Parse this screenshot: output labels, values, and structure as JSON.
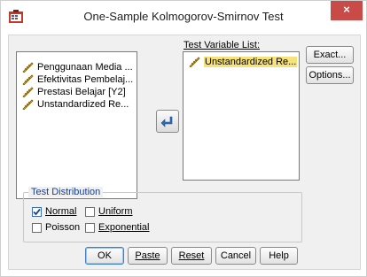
{
  "window": {
    "title": "One-Sample Kolmogorov-Smirnov Test",
    "close_glyph": "×",
    "icon": "spss-dialog-icon"
  },
  "source_list": {
    "items": [
      {
        "label": "Penggunaan Media ...",
        "icon": "scale-variable-icon"
      },
      {
        "label": "Efektivitas Pembelaj...",
        "icon": "scale-variable-icon"
      },
      {
        "label": "Prestasi Belajar [Y2]",
        "icon": "scale-variable-icon"
      },
      {
        "label": "Unstandardized Re...",
        "icon": "scale-variable-icon"
      }
    ]
  },
  "test_variable_list": {
    "label": "Test Variable List:",
    "items": [
      {
        "label": "Unstandardized Re...",
        "icon": "scale-variable-icon",
        "selected": true
      }
    ]
  },
  "move_button": {
    "icon": "arrow-left-icon"
  },
  "side_buttons": {
    "exact": "Exact...",
    "options": "Options..."
  },
  "test_distribution": {
    "legend": "Test Distribution",
    "normal": {
      "label": "Normal",
      "checked": true
    },
    "uniform": {
      "label": "Uniform",
      "checked": false
    },
    "poisson": {
      "label": "Poisson",
      "checked": false
    },
    "exponential": {
      "label": "Exponential",
      "checked": false
    }
  },
  "bottom_buttons": {
    "ok": "OK",
    "paste": "Paste",
    "reset": "Reset",
    "cancel": "Cancel",
    "help": "Help"
  },
  "colors": {
    "selection": "#f6e27a",
    "close": "#c94b47",
    "legend": "#1a3f8f",
    "default_button": "#3f7fc8"
  }
}
